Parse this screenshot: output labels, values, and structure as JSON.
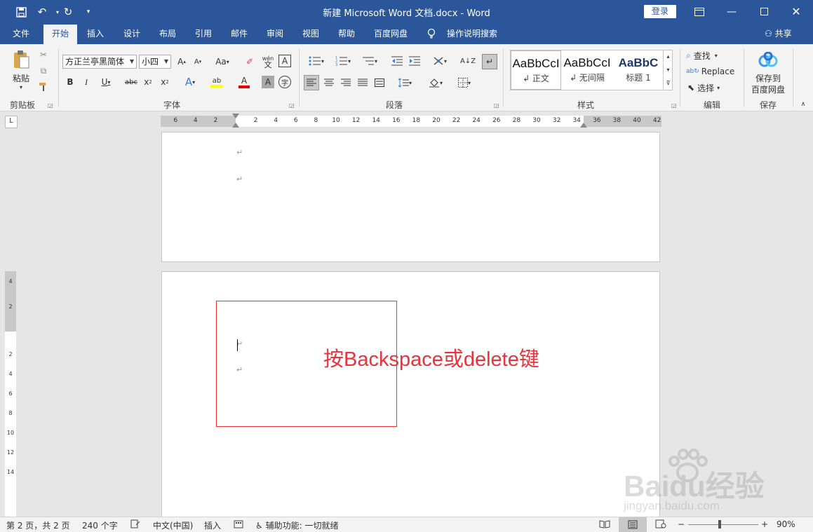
{
  "titlebar": {
    "title": "新建 Microsoft Word 文档.docx  -  Word",
    "login": "登录",
    "icons": [
      "save-icon",
      "undo-icon",
      "redo-icon",
      "customize-icon"
    ]
  },
  "tabs": [
    {
      "label": "文件"
    },
    {
      "label": "开始"
    },
    {
      "label": "插入"
    },
    {
      "label": "设计"
    },
    {
      "label": "布局"
    },
    {
      "label": "引用"
    },
    {
      "label": "邮件"
    },
    {
      "label": "审阅"
    },
    {
      "label": "视图"
    },
    {
      "label": "帮助"
    },
    {
      "label": "百度网盘"
    },
    {
      "label": "操作说明搜索"
    }
  ],
  "share_label": "共享",
  "ribbon": {
    "clipboard": {
      "paste": "粘贴",
      "group": "剪贴板"
    },
    "font": {
      "name": "方正兰亭黑简体",
      "size": "小四",
      "group": "字体",
      "aa": "Aa",
      "wen": "wén"
    },
    "paragraph": {
      "group": "段落"
    },
    "styles": {
      "group": "样式",
      "items": [
        {
          "preview": "AaBbCcI",
          "name": "↲ 正文"
        },
        {
          "preview": "AaBbCcI",
          "name": "↲ 无间隔"
        },
        {
          "preview": "AaBbC",
          "name": "标题 1"
        }
      ]
    },
    "editing": {
      "find": "查找",
      "replace": "Replace",
      "select": "选择",
      "group": "编辑"
    },
    "save": {
      "label1": "保存到",
      "label2": "百度网盘",
      "group": "保存"
    }
  },
  "ruler": {
    "corner": "L",
    "ticks": [
      "6",
      "4",
      "2",
      "2",
      "4",
      "6",
      "8",
      "10",
      "12",
      "14",
      "16",
      "18",
      "20",
      "22",
      "24",
      "26",
      "28",
      "30",
      "32",
      "34",
      "36",
      "38",
      "40",
      "42"
    ],
    "vticks": [
      "4",
      "2",
      "2",
      "4",
      "6",
      "8",
      "10",
      "12",
      "14"
    ]
  },
  "document": {
    "annotation": "按Backspace或delete键",
    "para_mark": "↵"
  },
  "watermark": {
    "logo": "Baidu经验",
    "url": "jingyan.baidu.com"
  },
  "statusbar": {
    "page": "第 2 页，共 2 页",
    "words": "240 个字",
    "language": "中文(中国)",
    "mode": "插入",
    "accessibility": "辅助功能: 一切就绪",
    "zoom": "90%",
    "zoom_minus": "−",
    "zoom_plus": "+"
  },
  "colors": {
    "brand": "#2b579a",
    "annotation": "#e8323c"
  }
}
